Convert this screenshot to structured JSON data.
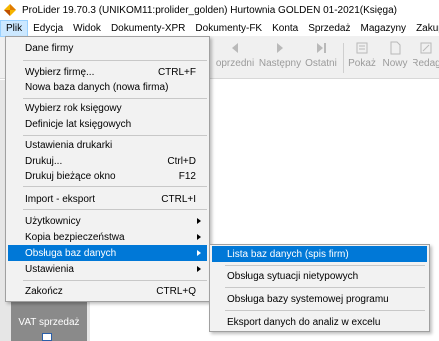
{
  "window": {
    "title": "ProLider 19.70.3  (UNIKOM11:prolider_golden) Hurtownia GOLDEN 01-2021(Księga)"
  },
  "menubar": [
    "Plik",
    "Edycja",
    "Widok",
    "Dokumenty-XPR",
    "Dokumenty-FK",
    "Konta",
    "Sprzedaż",
    "Magazyny",
    "Zakupy"
  ],
  "toolbar": {
    "items": [
      {
        "label": "oprzedni",
        "icon": "previous-icon"
      },
      {
        "label": "Następny",
        "icon": "next-icon"
      },
      {
        "label": "Ostatni",
        "icon": "last-icon"
      },
      {
        "label": "Pokaż",
        "icon": "show-icon"
      },
      {
        "label": "Nowy",
        "icon": "new-icon"
      },
      {
        "label": "Redag",
        "icon": "edit-icon"
      }
    ]
  },
  "plik_menu": [
    {
      "label": "Dane firmy",
      "shortcut": ""
    },
    {
      "label": "Wybierz firmę...",
      "shortcut": "CTRL+F"
    },
    {
      "label": "Nowa baza danych (nowa firma)",
      "shortcut": ""
    },
    {
      "label": "Wybierz rok księgowy",
      "shortcut": ""
    },
    {
      "label": "Definicje lat księgowych",
      "shortcut": ""
    },
    {
      "label": "Ustawienia drukarki",
      "shortcut": ""
    },
    {
      "label": "Drukuj...",
      "shortcut": "Ctrl+D"
    },
    {
      "label": "Drukuj bieżące okno",
      "shortcut": "F12"
    },
    {
      "label": "Import - eksport",
      "shortcut": "CTRL+I"
    },
    {
      "label": "Użytkownicy",
      "shortcut": ""
    },
    {
      "label": "Kopia bezpieczeństwa",
      "shortcut": ""
    },
    {
      "label": "Obsługa baz danych",
      "shortcut": ""
    },
    {
      "label": "Ustawienia",
      "shortcut": ""
    },
    {
      "label": "Zakończ",
      "shortcut": "CTRL+Q"
    }
  ],
  "submenu": [
    {
      "label": "Lista baz danych (spis firm)"
    },
    {
      "label": "Obsługa sytuacji nietypowych"
    },
    {
      "label": "Obsługa bazy systemowej  programu"
    },
    {
      "label": "Eksport danych do analiz w excelu"
    }
  ],
  "leftpanel": {
    "tile_label": "VAT sprzedaż"
  },
  "colors": {
    "highlight": "#0078d7",
    "menu_bg": "#f2f2f2",
    "tile_bg": "#8a8a8a"
  }
}
